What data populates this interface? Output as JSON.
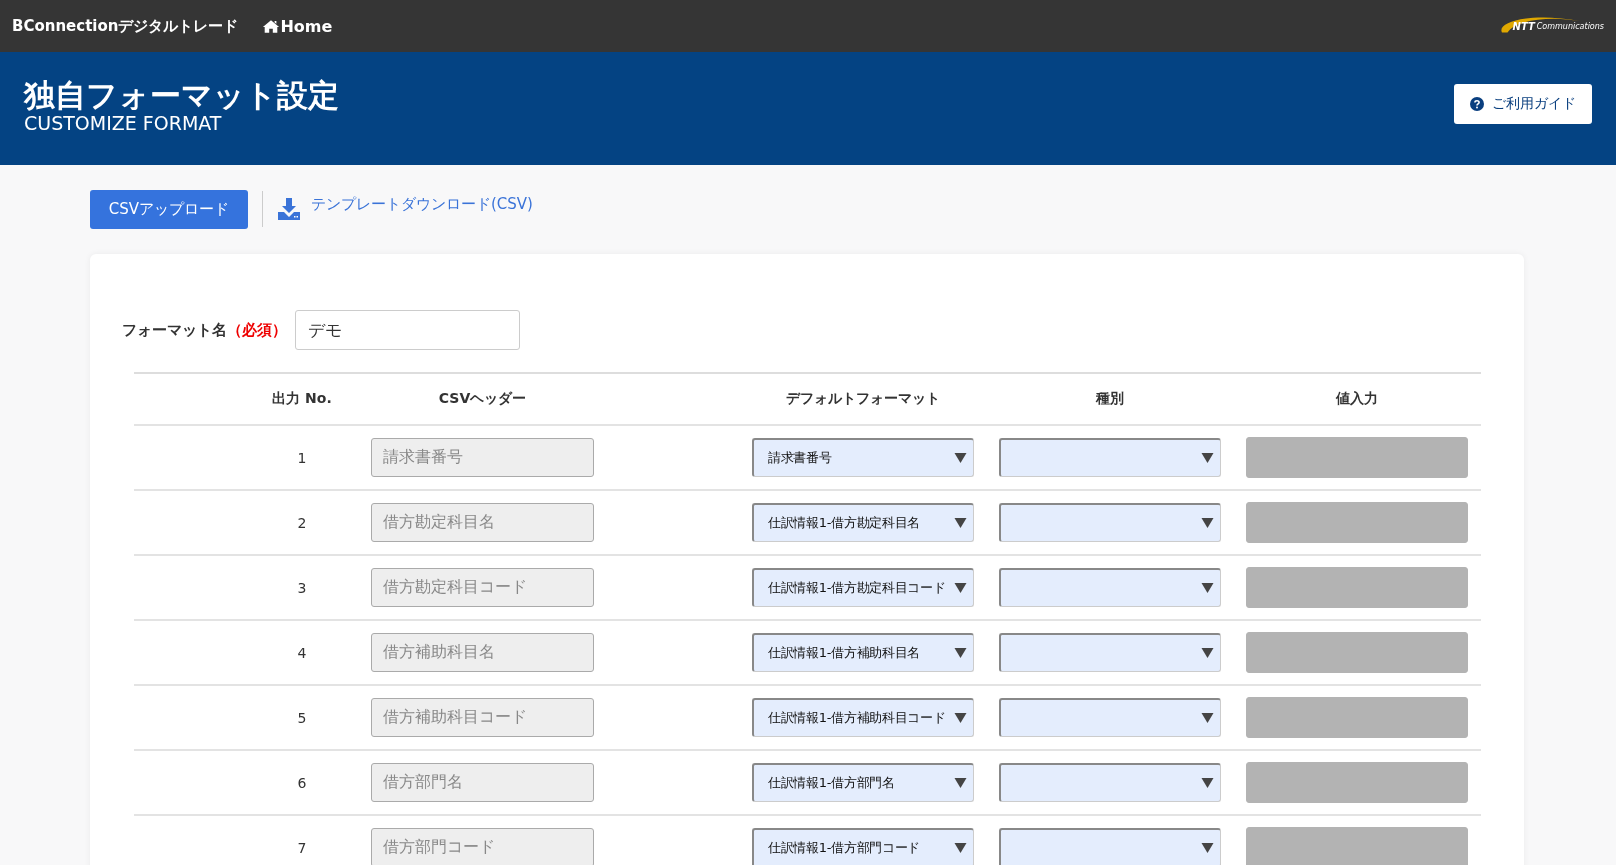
{
  "topbar": {
    "brand": "BConnectionデジタルトレード",
    "home_link": "Home",
    "logo": {
      "mark": "NTT",
      "text": "Communications"
    }
  },
  "header": {
    "title": "独自フォーマット設定",
    "subtitle": "CUSTOMIZE FORMAT",
    "guide_button": "ご利用ガイド"
  },
  "toolbar": {
    "upload_button": "CSVアップロード",
    "download_link": "テンプレートダウンロード(CSV)"
  },
  "format_name": {
    "label": "フォーマット名",
    "required": "（必須）",
    "value": "デモ"
  },
  "table": {
    "columns": [
      "出力 No.",
      "CSVヘッダー",
      "デフォルトフォーマット",
      "種別",
      "値入力"
    ],
    "rows": [
      {
        "no": "1",
        "csv_header": "請求書番号",
        "disabled": true,
        "default_format": "請求書番号",
        "kind": "",
        "value_disabled": true
      },
      {
        "no": "2",
        "csv_header": "借方勘定科目名",
        "disabled": true,
        "default_format": "仕訳情報1-借方勘定科目名",
        "kind": "",
        "value_disabled": true
      },
      {
        "no": "3",
        "csv_header": "借方勘定科目コード",
        "disabled": true,
        "default_format": "仕訳情報1-借方勘定科目コード",
        "kind": "",
        "value_disabled": true
      },
      {
        "no": "4",
        "csv_header": "借方補助科目名",
        "disabled": true,
        "default_format": "仕訳情報1-借方補助科目名",
        "kind": "",
        "value_disabled": true
      },
      {
        "no": "5",
        "csv_header": "借方補助科目コード",
        "disabled": true,
        "default_format": "仕訳情報1-借方補助科目コード",
        "kind": "",
        "value_disabled": true
      },
      {
        "no": "6",
        "csv_header": "借方部門名",
        "disabled": true,
        "default_format": "仕訳情報1-借方部門名",
        "kind": "",
        "value_disabled": true
      },
      {
        "no": "7",
        "csv_header": "借方部門コード",
        "disabled": true,
        "default_format": "仕訳情報1-借方部門コード",
        "kind": "",
        "value_disabled": true
      }
    ]
  }
}
